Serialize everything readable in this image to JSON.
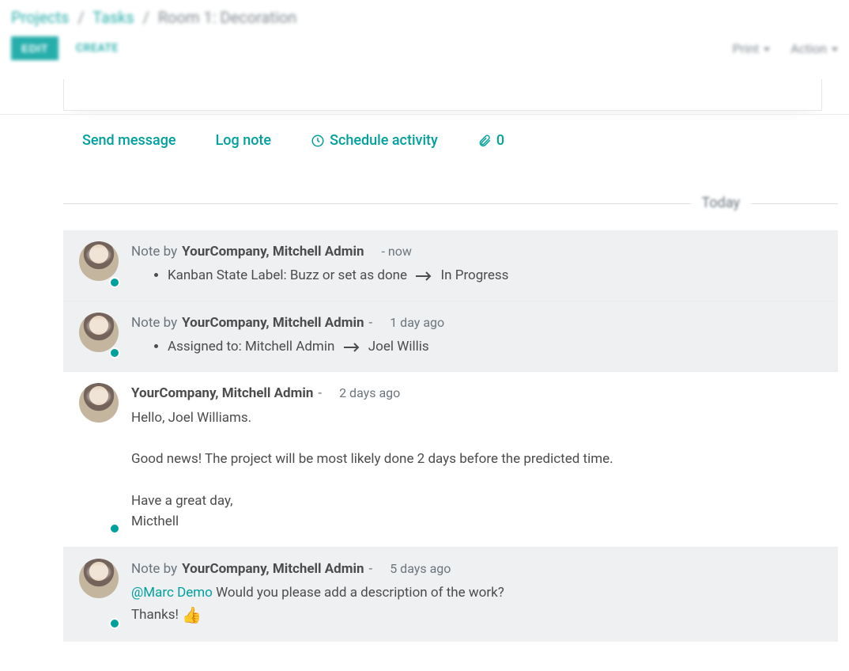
{
  "breadcrumb": {
    "root": "Projects",
    "parent": "Tasks",
    "current": "Room 1: Decoration"
  },
  "buttons": {
    "edit": "EDIT",
    "create": "CREATE",
    "print": "Print",
    "action": "Action"
  },
  "chatter": {
    "send_message": "Send message",
    "log_note": "Log note",
    "schedule_activity": "Schedule activity",
    "attachments_count": "0",
    "separator_label": "Today"
  },
  "messages": [
    {
      "type": "note",
      "note_prefix": "Note by",
      "author": "YourCompany, Mitchell Admin",
      "time": "- now",
      "change": {
        "field": "Kanban State Label:",
        "from": "Buzz or set as done",
        "to": "In Progress"
      }
    },
    {
      "type": "note",
      "note_prefix": "Note by",
      "author": "YourCompany, Mitchell Admin",
      "dash": "-",
      "time_num": "1 day",
      "time_suffix": "ago",
      "change": {
        "field": "Assigned to:",
        "from": "Mitchell Admin",
        "to": "Joel Willis"
      }
    },
    {
      "type": "message",
      "author": "YourCompany, Mitchell Admin",
      "dash": "-",
      "time_num": "2 days",
      "time_suffix": "ago",
      "body": "Hello, Joel Williams.\n\nGood news! The project will be most likely done 2 days before the predicted time.\n\nHave a great day,\nMicthell"
    },
    {
      "type": "note",
      "note_prefix": "Note by",
      "author": "YourCompany, Mitchell Admin",
      "dash": "-",
      "time_num": "5 days",
      "time_suffix": "ago",
      "mention": "@Marc Demo",
      "body_after_mention": " Would you please add a description of the work?",
      "body_line2": "Thanks! ",
      "emoji": "👍"
    }
  ]
}
